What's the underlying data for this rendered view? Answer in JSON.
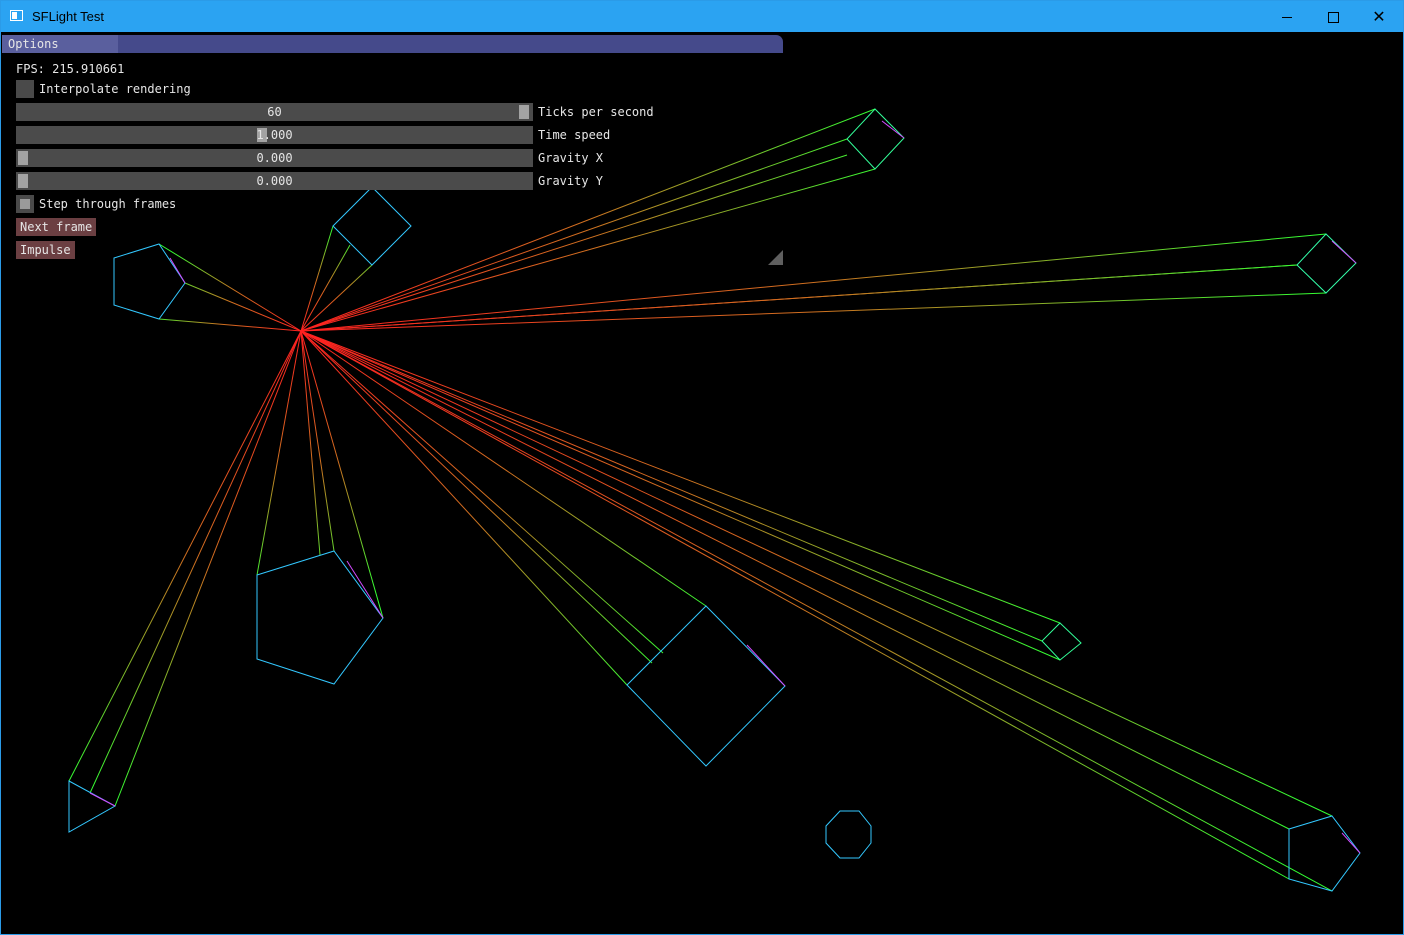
{
  "window": {
    "title": "SFLight Test"
  },
  "panel": {
    "title": "Options",
    "fps_label": "FPS: 215.910661",
    "interpolate_label": "Interpolate rendering",
    "sliders": [
      {
        "label": "Ticks per second",
        "value": "60",
        "fraction": 0.985
      },
      {
        "label": "Time speed",
        "value": "1.000",
        "fraction": 0.47
      },
      {
        "label": "Gravity X",
        "value": "0.000",
        "fraction": 0.0
      },
      {
        "label": "Gravity Y",
        "value": "0.000",
        "fraction": 0.0
      }
    ],
    "step_label": "Step through frames",
    "next_frame_label": "Next frame",
    "impulse_label": "Impulse"
  },
  "colors": {
    "titlebar": "#2ba3f2",
    "panel_title": "#454a8b",
    "button": "#6b3f42",
    "ray_near": "#ff2020",
    "ray_far": "#33ff33",
    "shape_edge": "#33c8ff",
    "shape_accent": "#d24bff"
  }
}
